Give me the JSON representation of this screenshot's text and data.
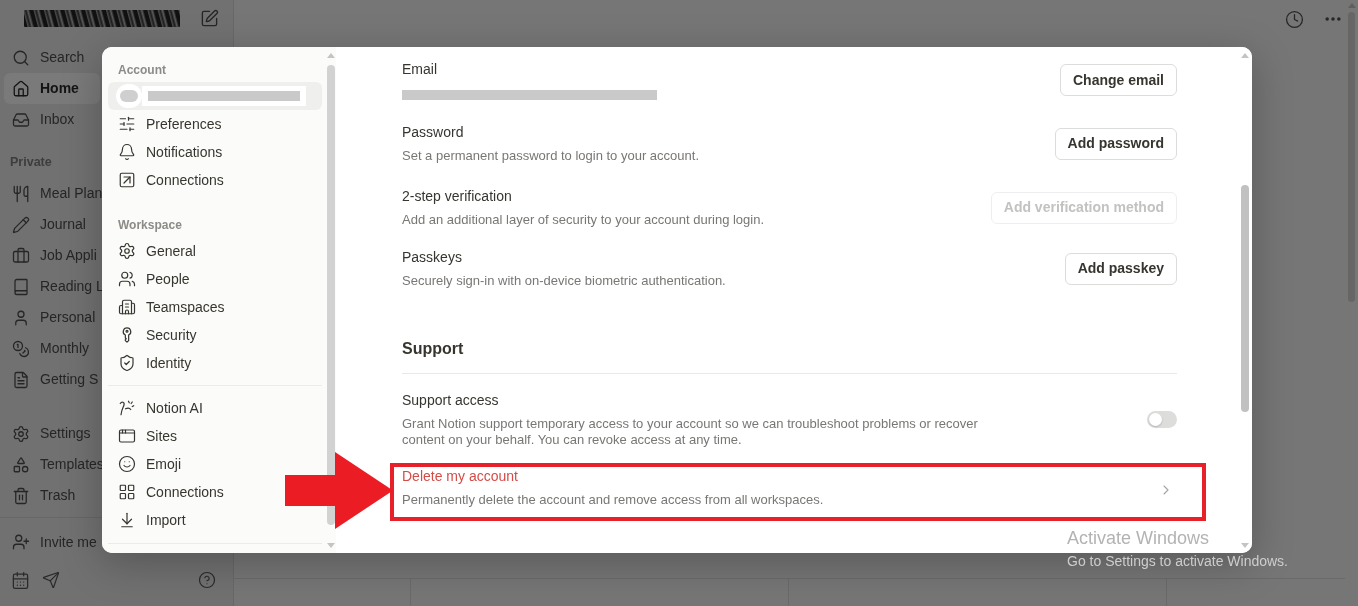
{
  "sidebar": {
    "items": [
      {
        "label": "Search",
        "selected": false
      },
      {
        "label": "Home",
        "selected": true
      },
      {
        "label": "Inbox",
        "selected": false
      }
    ],
    "private": {
      "label": "Private",
      "items": [
        {
          "label": "Meal Plan",
          "selected": false
        },
        {
          "label": "Journal",
          "selected": false
        },
        {
          "label": "Job Appli",
          "selected": false
        },
        {
          "label": "Reading L",
          "selected": false
        },
        {
          "label": "Personal",
          "selected": false
        },
        {
          "label": "Monthly",
          "selected": false
        },
        {
          "label": "Getting S",
          "selected": false
        }
      ]
    },
    "bottom_items": [
      {
        "label": "Settings",
        "selected": false
      },
      {
        "label": "Templates",
        "selected": false
      },
      {
        "label": "Trash",
        "selected": false
      }
    ],
    "invite": {
      "label": "Invite me"
    }
  },
  "settings_nav": {
    "sections": [
      {
        "label": "Account",
        "account_row": {
          "selected": true
        },
        "items": [
          {
            "label": "Preferences",
            "selected": false
          },
          {
            "label": "Notifications",
            "selected": false
          },
          {
            "label": "Connections",
            "selected": false
          }
        ]
      },
      {
        "label": "Workspace",
        "items": [
          {
            "label": "General",
            "selected": false
          },
          {
            "label": "People",
            "selected": false
          },
          {
            "label": "Teamspaces",
            "selected": false
          },
          {
            "label": "Security",
            "selected": false
          },
          {
            "label": "Identity",
            "selected": false
          }
        ]
      },
      {
        "items": [
          {
            "label": "Notion AI",
            "selected": false
          },
          {
            "label": "Sites",
            "selected": false
          },
          {
            "label": "Emoji",
            "selected": false
          },
          {
            "label": "Connections",
            "selected": false
          },
          {
            "label": "Import",
            "selected": false
          }
        ]
      }
    ]
  },
  "account_settings": {
    "rows": [
      {
        "kind": "email",
        "label": "Email",
        "button": {
          "label": "Change email",
          "disabled": false
        }
      },
      {
        "kind": "text",
        "label": "Password",
        "description": "Set a permanent password to login to your account.",
        "button": {
          "label": "Add password",
          "disabled": false
        }
      },
      {
        "kind": "text",
        "label": "2-step verification",
        "description": "Add an additional layer of security to your account during login.",
        "button": {
          "label": "Add verification method",
          "disabled": true
        }
      },
      {
        "kind": "text",
        "label": "Passkeys",
        "description": "Securely sign-in with on-device biometric authentication.",
        "button": {
          "label": "Add passkey",
          "disabled": false
        }
      }
    ]
  },
  "support": {
    "heading": "Support",
    "rows": [
      {
        "kind": "toggle",
        "label": "Support access",
        "description": "Grant Notion support temporary access to your account so we can troubleshoot problems or recover content on your behalf. You can revoke access at any time.",
        "on": false
      },
      {
        "kind": "link",
        "label": "Delete my account",
        "description": "Permanently delete the account and remove access from all workspaces.",
        "danger": true,
        "highlighted": true
      }
    ]
  },
  "os_watermark": {
    "title": "Activate Windows",
    "subtitle": "Go to Settings to activate Windows."
  }
}
